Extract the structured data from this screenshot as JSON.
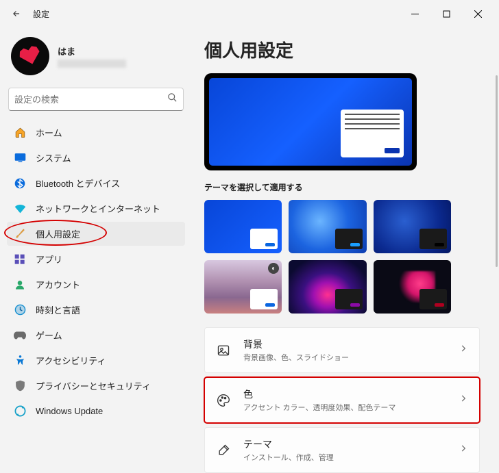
{
  "window": {
    "title": "設定"
  },
  "user": {
    "name": "はま"
  },
  "search": {
    "placeholder": "設定の検索"
  },
  "nav": {
    "home": "ホーム",
    "system": "システム",
    "bluetooth": "Bluetooth とデバイス",
    "network": "ネットワークとインターネット",
    "personalization": "個人用設定",
    "apps": "アプリ",
    "accounts": "アカウント",
    "time_language": "時刻と言語",
    "gaming": "ゲーム",
    "accessibility": "アクセシビリティ",
    "privacy": "プライバシーとセキュリティ",
    "update": "Windows Update"
  },
  "page": {
    "title": "個人用設定",
    "theme_label": "テーマを選択して適用する"
  },
  "rows": {
    "background": {
      "title": "背景",
      "desc": "背景画像、色、スライドショー"
    },
    "colors": {
      "title": "色",
      "desc": "アクセント カラー、透明度効果、配色テーマ"
    },
    "themes": {
      "title": "テーマ",
      "desc": "インストール、作成、管理"
    }
  }
}
